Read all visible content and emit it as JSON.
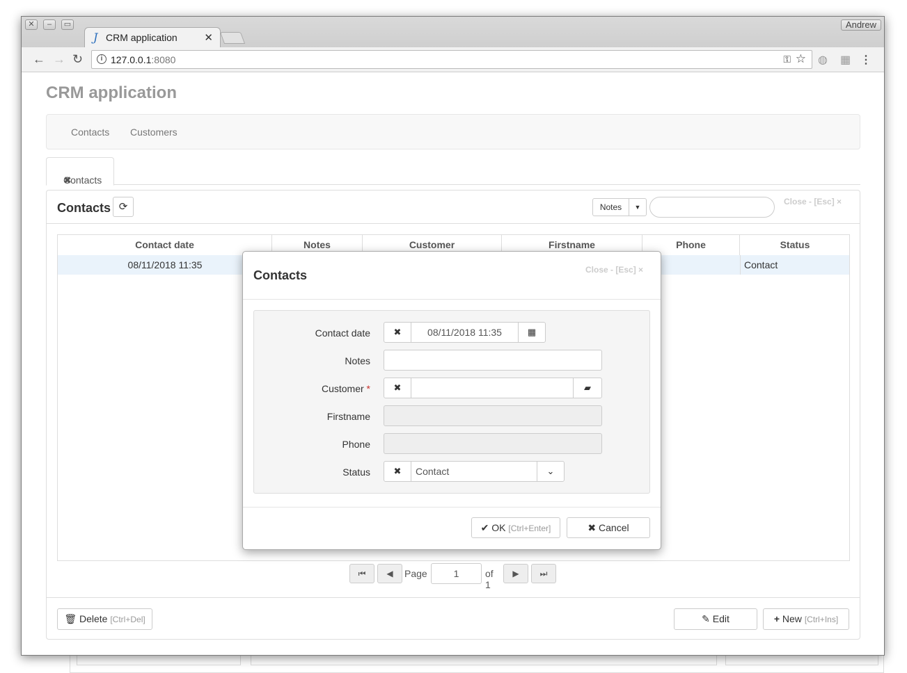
{
  "browser": {
    "tab_title": "CRM application",
    "tab_favicon": "J",
    "user": "Andrew",
    "url_host": "127.0.0.1",
    "url_port": ":8080"
  },
  "app": {
    "title": "CRM application",
    "nav": [
      "Contacts",
      "Customers"
    ],
    "open_tab": "Contacts"
  },
  "panel": {
    "title": "Contacts",
    "filter_field": "Notes",
    "search_value": "",
    "close_label": "Close - [Esc] ×",
    "columns": [
      "Contact date",
      "Notes",
      "Customer",
      "Firstname",
      "Phone",
      "Status"
    ],
    "rows": [
      {
        "contact_date": "08/11/2018 11:35",
        "notes": "",
        "customer": "",
        "firstname": "",
        "phone": "",
        "status": "Contact"
      }
    ],
    "pager": {
      "page_label": "Page",
      "page": "1",
      "of_label": "of 1"
    },
    "footer": {
      "delete_label": "Delete",
      "delete_hint": "[Ctrl+Del]",
      "edit_label": "Edit",
      "new_label": "New",
      "new_hint": "[Ctrl+Ins]"
    }
  },
  "dialog": {
    "title": "Contacts",
    "close_label": "Close - [Esc] ×",
    "fields": {
      "contact_date": {
        "label": "Contact date",
        "value": "08/11/2018 11:35"
      },
      "notes": {
        "label": "Notes",
        "value": ""
      },
      "customer": {
        "label": "Customer",
        "required_mark": "*",
        "value": ""
      },
      "firstname": {
        "label": "Firstname",
        "value": ""
      },
      "phone": {
        "label": "Phone",
        "value": ""
      },
      "status": {
        "label": "Status",
        "value": "Contact"
      }
    },
    "ok_label": "OK",
    "ok_hint": "[Ctrl+Enter]",
    "cancel_label": "Cancel"
  },
  "icons": {
    "refresh": "refresh-icon",
    "trash": "trash-icon",
    "edit": "edit-icon",
    "plus": "plus-icon",
    "check": "check-icon",
    "times": "times-icon",
    "calendar": "calendar-icon",
    "folder": "folder-open-icon",
    "clear": "clear-circle-icon",
    "chevron": "chevron-down-icon"
  }
}
